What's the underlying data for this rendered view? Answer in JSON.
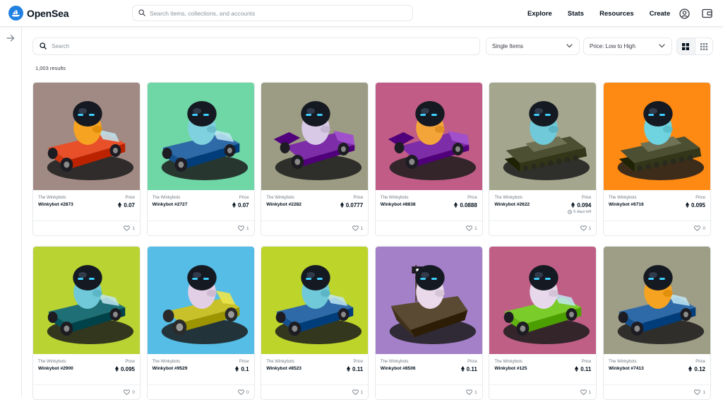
{
  "brand": {
    "name": "OpenSea",
    "color": "#2081e2"
  },
  "header": {
    "search_placeholder": "Search items, collections, and accounts",
    "nav": [
      "Explore",
      "Stats",
      "Resources",
      "Create"
    ],
    "icons": [
      "account-icon",
      "wallet-icon"
    ]
  },
  "filters": {
    "search_placeholder": "Search",
    "type_select": "Single Items",
    "sort_select": "Price: Low to High",
    "results": "1,003 results"
  },
  "price_label": "Price",
  "items": [
    {
      "collection": "The Winkybots",
      "name": "Winkybot #2873",
      "price": "0.07",
      "likes": "1",
      "bg": "#a18a84",
      "body": "#f6a321",
      "vehicle": "#e8502a",
      "vtype": "car"
    },
    {
      "collection": "The Winkybots",
      "name": "Winkybot #2727",
      "price": "0.07",
      "likes": "1",
      "bg": "#6fd6a6",
      "body": "#7fd1e0",
      "vehicle": "#2f6aa8",
      "vtype": "car"
    },
    {
      "collection": "The Winkybots",
      "name": "Winkybot #2282",
      "price": "0.0777",
      "likes": "1",
      "bg": "#9c9b83",
      "body": "#d8c9e6",
      "vehicle": "#7d2da7",
      "vtype": "kart"
    },
    {
      "collection": "The Winkybots",
      "name": "Winkybot #8838",
      "price": "0.0888",
      "likes": "1",
      "bg": "#c05c86",
      "body": "#f4a53a",
      "vehicle": "#7d2da7",
      "vtype": "kart"
    },
    {
      "collection": "The Winkybots",
      "name": "Winkybot #2622",
      "price": "0.094",
      "likes": "1",
      "sub": "6 days left",
      "bg": "#a4a68e",
      "body": "#6fc9d8",
      "vehicle": "#4c4f31",
      "vtype": "tank"
    },
    {
      "collection": "The Winkybots",
      "name": "Winkybot #6716",
      "price": "0.095",
      "likes": "0",
      "bg": "#ff8a13",
      "body": "#6fd3e0",
      "vehicle": "#4c4f31",
      "vtype": "tank"
    },
    {
      "collection": "The Winkybots",
      "name": "Winkybot #2900",
      "price": "0.095",
      "likes": "0",
      "bg": "#b9d432",
      "body": "#6fc9d8",
      "vehicle": "#1f6f76",
      "vtype": "car"
    },
    {
      "collection": "The Winkybots",
      "name": "Winkybot #9529",
      "price": "0.1",
      "likes": "0",
      "bg": "#55bde6",
      "body": "#e2cfe6",
      "vehicle": "#c9c129",
      "vtype": "jeep"
    },
    {
      "collection": "The Winkybots",
      "name": "Winkybot #8523",
      "price": "0.11",
      "likes": "1",
      "bg": "#bdd42b",
      "body": "#6fc9d8",
      "vehicle": "#2f6aa8",
      "vtype": "car"
    },
    {
      "collection": "The Winkybots",
      "name": "Winkybot #8506",
      "price": "0.11",
      "likes": "1",
      "bg": "#a480c9",
      "body": "#ead9ea",
      "vehicle": "#5a4a33",
      "vtype": "ship"
    },
    {
      "collection": "The Winkybots",
      "name": "Winkybot #125",
      "price": "0.11",
      "likes": "1",
      "bg": "#bf5f86",
      "body": "#e8d8ec",
      "vehicle": "#79cc2a",
      "vtype": "car"
    },
    {
      "collection": "The Winkybots",
      "name": "Winkybot #7413",
      "price": "0.12",
      "likes": "1",
      "bg": "#9e9d86",
      "body": "#f6a321",
      "vehicle": "#2f6aa8",
      "vtype": "car"
    }
  ]
}
